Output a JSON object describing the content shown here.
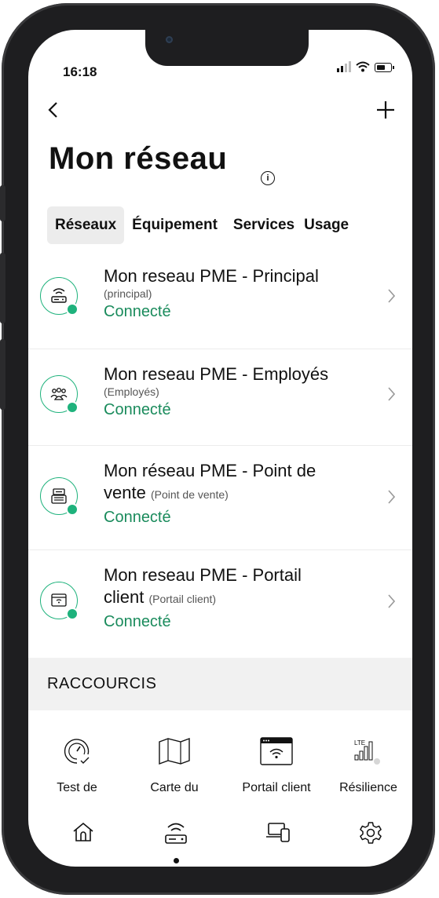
{
  "status_bar": {
    "time": "16:18"
  },
  "header": {
    "back_icon": "chevron-left-icon",
    "add_icon": "plus-icon",
    "title": "Mon réseau",
    "info_icon": "info-icon"
  },
  "tabs": [
    {
      "label": "Réseaux",
      "active": true
    },
    {
      "label": "Équipement",
      "active": false
    },
    {
      "label": "Services",
      "active": false
    },
    {
      "label": "Usage",
      "active": false
    }
  ],
  "networks": [
    {
      "name": "Mon reseau PME - Principal",
      "name_line2": "",
      "sub": "(principal)",
      "status": "Connecté",
      "icon": "router-icon"
    },
    {
      "name": "Mon reseau PME - Employés",
      "name_line2": "",
      "sub": "(Employés)",
      "status": "Connecté",
      "icon": "people-icon"
    },
    {
      "name": "Mon réseau PME - Point de",
      "name_line2": "vente",
      "sub": "(Point de vente)",
      "status": "Connecté",
      "icon": "cash-register-icon"
    },
    {
      "name": "Mon reseau PME - Portail",
      "name_line2": "client",
      "sub": "(Portail client)",
      "status": "Connecté",
      "icon": "portal-icon"
    }
  ],
  "shortcuts": {
    "heading": "RACCOURCIS",
    "items": [
      {
        "label": "Test de",
        "icon": "speedometer-icon"
      },
      {
        "label": "Carte du",
        "icon": "map-icon"
      },
      {
        "label": "Portail client",
        "icon": "portal-wifi-icon"
      },
      {
        "label": "Résilience",
        "icon": "lte-signal-icon"
      }
    ]
  },
  "bottom_nav": [
    {
      "name": "home",
      "icon": "home-icon"
    },
    {
      "name": "network",
      "icon": "router-icon",
      "active": true
    },
    {
      "name": "devices",
      "icon": "devices-icon"
    },
    {
      "name": "settings",
      "icon": "gear-icon"
    }
  ],
  "colors": {
    "accent": "#1eb27c",
    "status_text": "#1a8b5c",
    "section_bg": "#f1f1f1"
  }
}
